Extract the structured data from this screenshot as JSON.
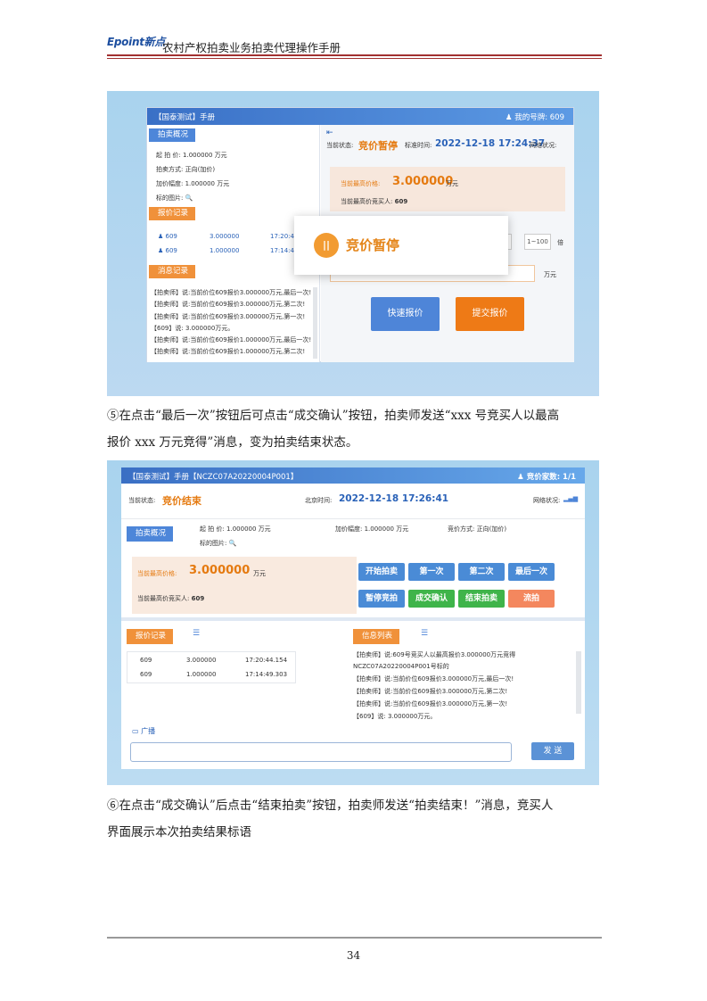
{
  "header": {
    "logo": "Epoint新点",
    "title": "农村产权拍卖业务拍卖代理操作手册"
  },
  "footer": {
    "page_number": "34"
  },
  "paragraphs": {
    "p5_line1": "⑤在点击“最后一次”按钮后可点击“成交确认”按钮，拍卖师发送“xxx 号竞买人以最高",
    "p5_line2": "报价 xxx 万元竞得”消息，变为拍卖结束状态。",
    "p6_line1": "⑥在点击“成交确认”后点击“结束拍卖”按钮，拍卖师发送“拍卖结束！”消息，竞买人",
    "p6_line2": "界面展示本次拍卖结果标语"
  },
  "screenshot1": {
    "title": "【国泰测试】手册",
    "my_bid_no": "我的号牌: 609",
    "overview_tag": "拍卖概况",
    "start_price": "起  拍  价:   1.000000 万元",
    "method": "拍卖方式:   正向(加价)",
    "increment": "加价幅度:   1.000000 万元",
    "target_image": "标的图片:",
    "bid_record_tag": "报价记录",
    "bids": [
      {
        "bidder": "609",
        "price": "3.000000",
        "time": "17:20:44.1"
      },
      {
        "bidder": "609",
        "price": "1.000000",
        "time": "17:14:49.3"
      }
    ],
    "message_tag": "消息记录",
    "messages": [
      "【拍卖师】说:当前价位609报价3.000000万元,最后一次!",
      "【拍卖师】说:当前价位609报价3.000000万元,第二次!",
      "【拍卖师】说:当前价位609报价3.000000万元,第一次!",
      "【609】说: 3.000000万元。",
      "【拍卖师】说:当前价位609报价1.000000万元,最后一次!",
      "【拍卖师】说:当前价位609报价1.000000万元,第二次!"
    ],
    "current_status_label": "当前状态:",
    "current_status": "竞价暂停",
    "time_label": "标准时间:",
    "time": "2022-12-18 17:24:37",
    "network_label": "网络状况:",
    "highest_label": "当前最高价格:",
    "highest_price": "3.000000",
    "highest_unit": "万元",
    "highest_bidder_label": "当前最高价竞买人:",
    "highest_bidder": "609",
    "range_hint": "1~100",
    "multiple_label": "倍",
    "unit_label": "万元",
    "quick_bid_btn": "快速报价",
    "submit_bid_btn": "提交报价",
    "popup_icon": "||",
    "popup_text": "竞价暂停"
  },
  "screenshot2": {
    "title": "【国泰测试】手册【NCZC07A20220004P001】",
    "bidder_count": "竞价家数: 1/1",
    "current_status_label": "当前状态:",
    "current_status": "竞价结束",
    "time_label": "北京时间:",
    "time": "2022-12-18 17:26:41",
    "network_label": "网络状况:",
    "overview_tag": "拍卖概况",
    "start_price": "起  拍  价:   1.000000 万元",
    "target_image": "标的图片:",
    "increment": "加价幅度:   1.000000 万元",
    "method": "竞价方式:   正向(加价)",
    "highest_label": "当前最高价格:",
    "highest_price": "3.000000",
    "highest_unit": "万元",
    "highest_bidder_label": "当前最高价竞买人:",
    "highest_bidder": "609",
    "buttons": {
      "start": "开始拍卖",
      "first": "第一次",
      "second": "第二次",
      "last": "最后一次",
      "pause": "暂停竞拍",
      "confirm": "成交确认",
      "end": "结束拍卖",
      "abort": "流拍"
    },
    "bid_record_tag": "报价记录",
    "bids": [
      {
        "bidder": "609",
        "price": "3.000000",
        "time": "17:20:44.154"
      },
      {
        "bidder": "609",
        "price": "1.000000",
        "time": "17:14:49.303"
      }
    ],
    "info_tag": "信息列表",
    "messages": [
      "【拍卖师】说:609号竞买人以最高报价3.000000万元竞得",
      "NCZC07A20220004P001号标的",
      "【拍卖师】说:当前价位609报价3.000000万元,最后一次!",
      "【拍卖师】说:当前价位609报价3.000000万元,第二次!",
      "【拍卖师】说:当前价位609报价3.000000万元,第一次!",
      "【609】说: 3.000000万元。"
    ],
    "broadcast_label": "广播",
    "send_btn": "发 送"
  },
  "colors": {
    "accent_orange": "#e57a10",
    "brand_blue": "#2a62b8",
    "header_red": "#a23131"
  }
}
